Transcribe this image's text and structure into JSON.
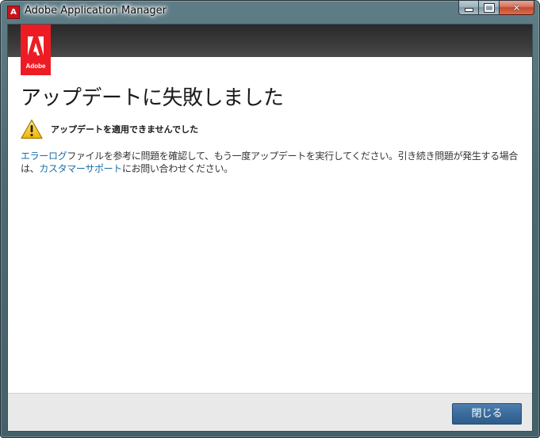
{
  "window": {
    "title": "Adobe Application Manager",
    "app_icon_glyph": "A",
    "app_icon": "adobe-app-icon",
    "minimize_icon": "minimize-icon",
    "maximize_icon": "maximize-icon",
    "close_icon": "close-icon",
    "close_glyph": "✕"
  },
  "header": {
    "logo_text": "Adobe",
    "logo_color": "#ed1c24"
  },
  "main": {
    "title": "アップデートに失敗しました",
    "warning": {
      "icon": "warning-icon",
      "text": "アップデートを適用できませんでした"
    },
    "message": {
      "link1": "エラーログ",
      "part1": "ファイルを参考に問題を確認して、もう一度アップデートを実行してください。引き続き問題が発生する場合は、",
      "link2": "カスタマーサポート",
      "part2": "にお問い合わせください。",
      "link_color": "#1a6ea8"
    }
  },
  "footer": {
    "close_label": "閉じる",
    "button_color": "#3a6b9b"
  }
}
